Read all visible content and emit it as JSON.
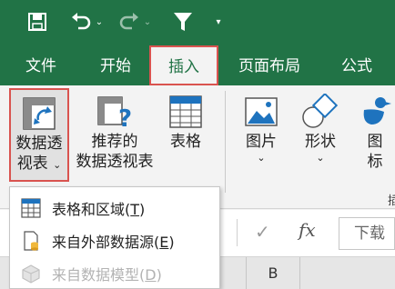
{
  "quick_access": {
    "save_icon": "save-icon",
    "undo_icon": "undo-icon",
    "redo_icon": "redo-icon",
    "filter_icon": "filter-icon",
    "customize_icon": "customize-qat-icon",
    "dropdown_glyph": "⌄",
    "customize_glyph": "▾"
  },
  "tabs": [
    {
      "label": "文件"
    },
    {
      "label": "开始"
    },
    {
      "label": "插入",
      "active": true
    },
    {
      "label": "页面布局"
    },
    {
      "label": "公式"
    }
  ],
  "ribbon": {
    "pivot_table": {
      "line1": "数据透",
      "line2": "视表",
      "caret": "⌄"
    },
    "recommended_pivot": {
      "line1": "推荐的",
      "line2": "数据透视表"
    },
    "table": {
      "label": "表格"
    },
    "pictures": {
      "label": "图片",
      "caret": "⌄"
    },
    "shapes": {
      "label": "形状",
      "caret": "⌄"
    },
    "icons": {
      "line1": "图",
      "line2": "标"
    },
    "group_label_fragment": "插"
  },
  "menu": {
    "items": [
      {
        "text": "表格和区域(",
        "key": "T",
        "close": ")",
        "enabled": true
      },
      {
        "text": "来自外部数据源(",
        "key": "E",
        "close": ")",
        "enabled": true
      },
      {
        "text": "来自数据模型(",
        "key": "D",
        "close": ")",
        "enabled": false
      }
    ]
  },
  "formula_bar": {
    "check": "✓",
    "fx": "fx",
    "value": "下载"
  },
  "columns": {
    "b": "B"
  },
  "colors": {
    "brand_green": "#217346",
    "highlight_red": "#d9534f",
    "disabled_text": "#b3b3b3"
  }
}
